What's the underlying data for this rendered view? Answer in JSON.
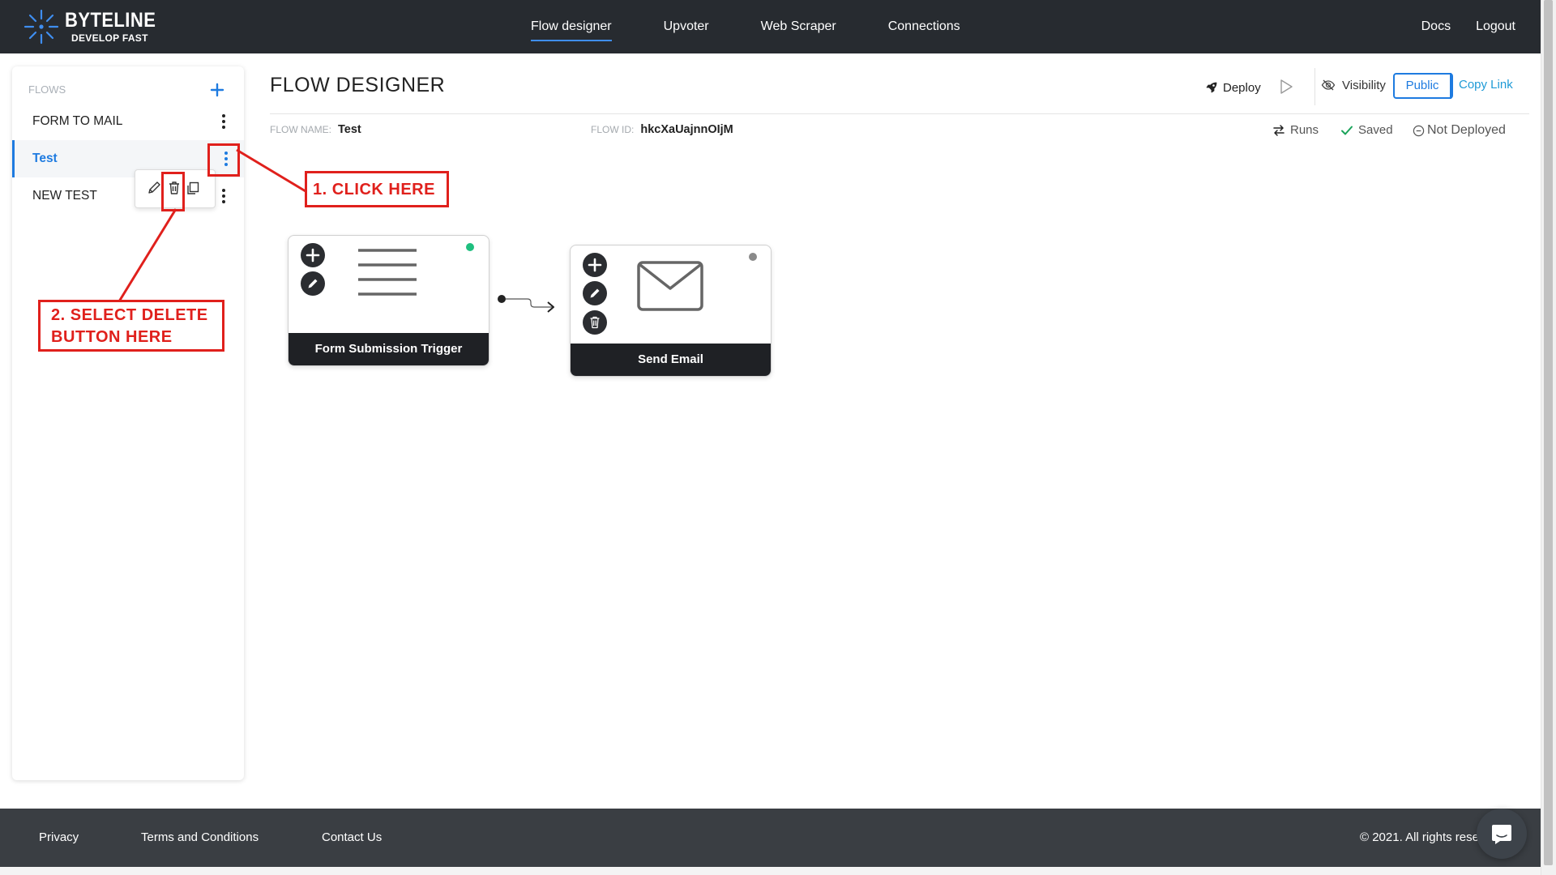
{
  "brand": {
    "name": "BYTELINE",
    "tagline": "DEVELOP FAST",
    "accent": "#3f8ef0"
  },
  "nav": {
    "items": [
      {
        "label": "Flow designer",
        "active": true
      },
      {
        "label": "Upvoter"
      },
      {
        "label": "Web Scraper"
      },
      {
        "label": "Connections"
      }
    ],
    "right": [
      {
        "label": "Docs"
      },
      {
        "label": "Logout"
      }
    ]
  },
  "sidebar": {
    "title": "FLOWS",
    "add_icon": "plus-icon",
    "items": [
      {
        "label": "FORM TO MAIL",
        "active": false
      },
      {
        "label": "Test",
        "active": true
      },
      {
        "label": "NEW TEST",
        "active": false
      }
    ],
    "popover_actions": [
      "edit-icon",
      "trash-icon",
      "copy-icon"
    ]
  },
  "main": {
    "title": "FLOW DESIGNER",
    "deploy_label": "Deploy",
    "visibility_label": "Visibility",
    "public_label": "Public",
    "copy_link_label": "Copy Link",
    "flow_name_key": "FLOW NAME:",
    "flow_name": "Test",
    "flow_id_key": "FLOW ID:",
    "flow_id": "hkcXaUajnnOIjM",
    "runs_label": "Runs",
    "saved_label": "Saved",
    "deploy_status": "Not Deployed"
  },
  "canvas": {
    "nodes": [
      {
        "title": "Form Submission Trigger",
        "icon": "form-lines-icon",
        "status_color": "#1fbf7f"
      },
      {
        "title": "Send Email",
        "icon": "envelope-icon",
        "status_color": "#8a8a8a"
      }
    ]
  },
  "annotations": {
    "step1": "1. CLICK HERE",
    "step2_line1": "2. SELECT DELETE",
    "step2_line2": "BUTTON HERE",
    "color": "#e0201c"
  },
  "footer": {
    "links": [
      "Privacy",
      "Terms and Conditions",
      "Contact Us"
    ],
    "copyright": "© 2021. All rights reserved."
  }
}
